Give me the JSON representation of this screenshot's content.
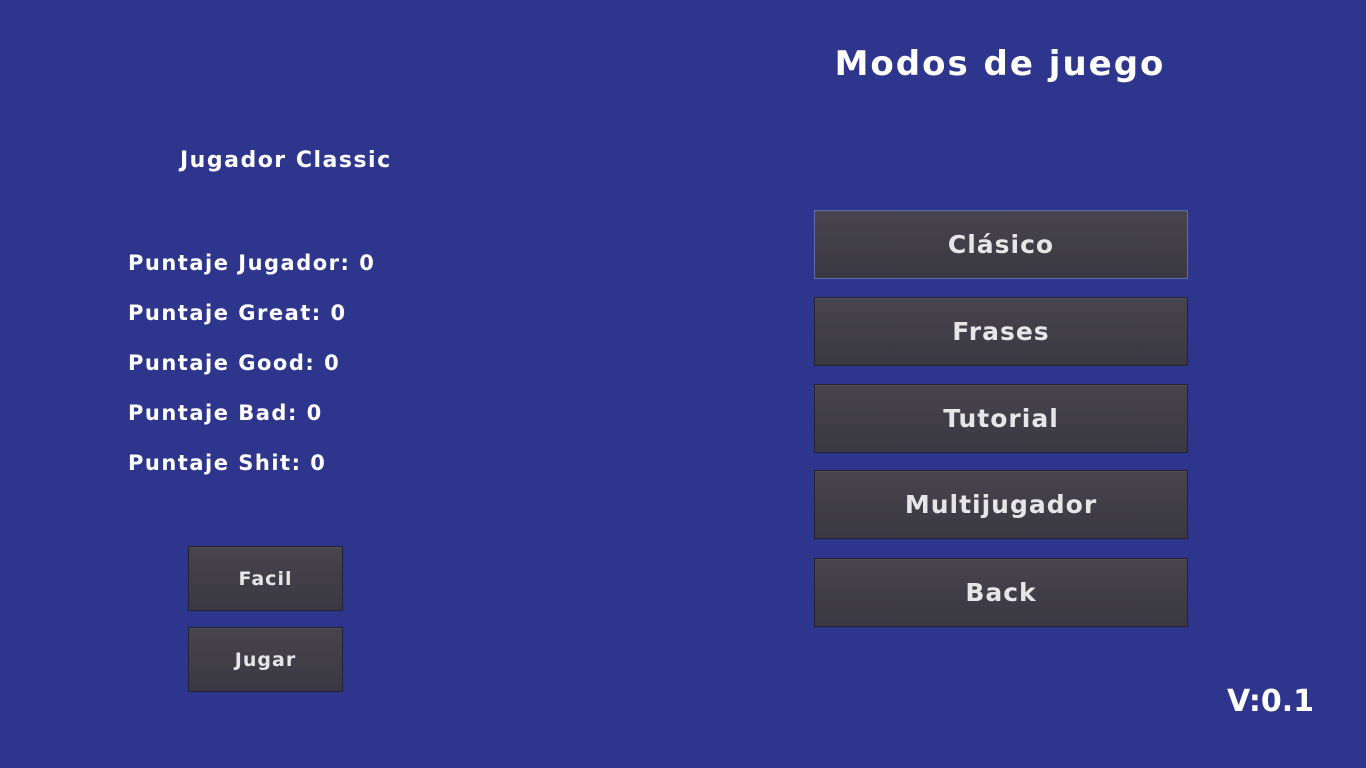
{
  "title": "Modos de juego",
  "player_name": "Jugador Classic",
  "scores": [
    "Puntaje Jugador: 0",
    "Puntaje Great: 0",
    "Puntaje Good: 0",
    "Puntaje Bad: 0",
    "Puntaje Shit: 0"
  ],
  "mode_buttons": {
    "classic": "Clásico",
    "phrases": "Frases",
    "tutorial": "Tutorial",
    "multiplayer": "Multijugador",
    "back": "Back"
  },
  "difficulty_button": "Facil",
  "play_button": "Jugar",
  "version": "V:0.1"
}
